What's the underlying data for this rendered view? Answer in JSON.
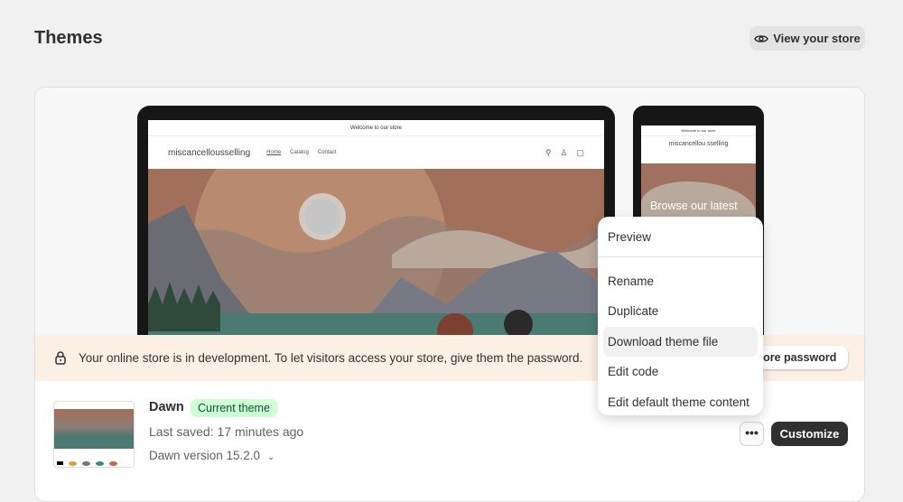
{
  "header": {
    "title": "Themes",
    "view_store": "View your store"
  },
  "preview": {
    "announcement": "Welcome to our store",
    "store_name": "miscancellousselling",
    "nav": [
      "Home",
      "Catalog",
      "Contact"
    ],
    "mobile_store_name": "miscancellou sselling",
    "mobile_hero": "Browse our latest"
  },
  "banner": {
    "message": "Your online store is in development. To let visitors access your store, give them the password.",
    "password_button": "store password"
  },
  "theme": {
    "name": "Dawn",
    "badge": "Current theme",
    "last_saved": "Last saved: 17 minutes ago",
    "version": "Dawn version 15.2.0",
    "customize": "Customize",
    "more": "•••"
  },
  "menu": {
    "items": [
      "Preview",
      "Rename",
      "Duplicate",
      "Download theme file",
      "Edit code",
      "Edit default theme content"
    ],
    "highlighted": "Download theme file"
  },
  "colors": {
    "banner": "#fcefe4",
    "badge": "#cdfed4",
    "primary": "#303030"
  }
}
